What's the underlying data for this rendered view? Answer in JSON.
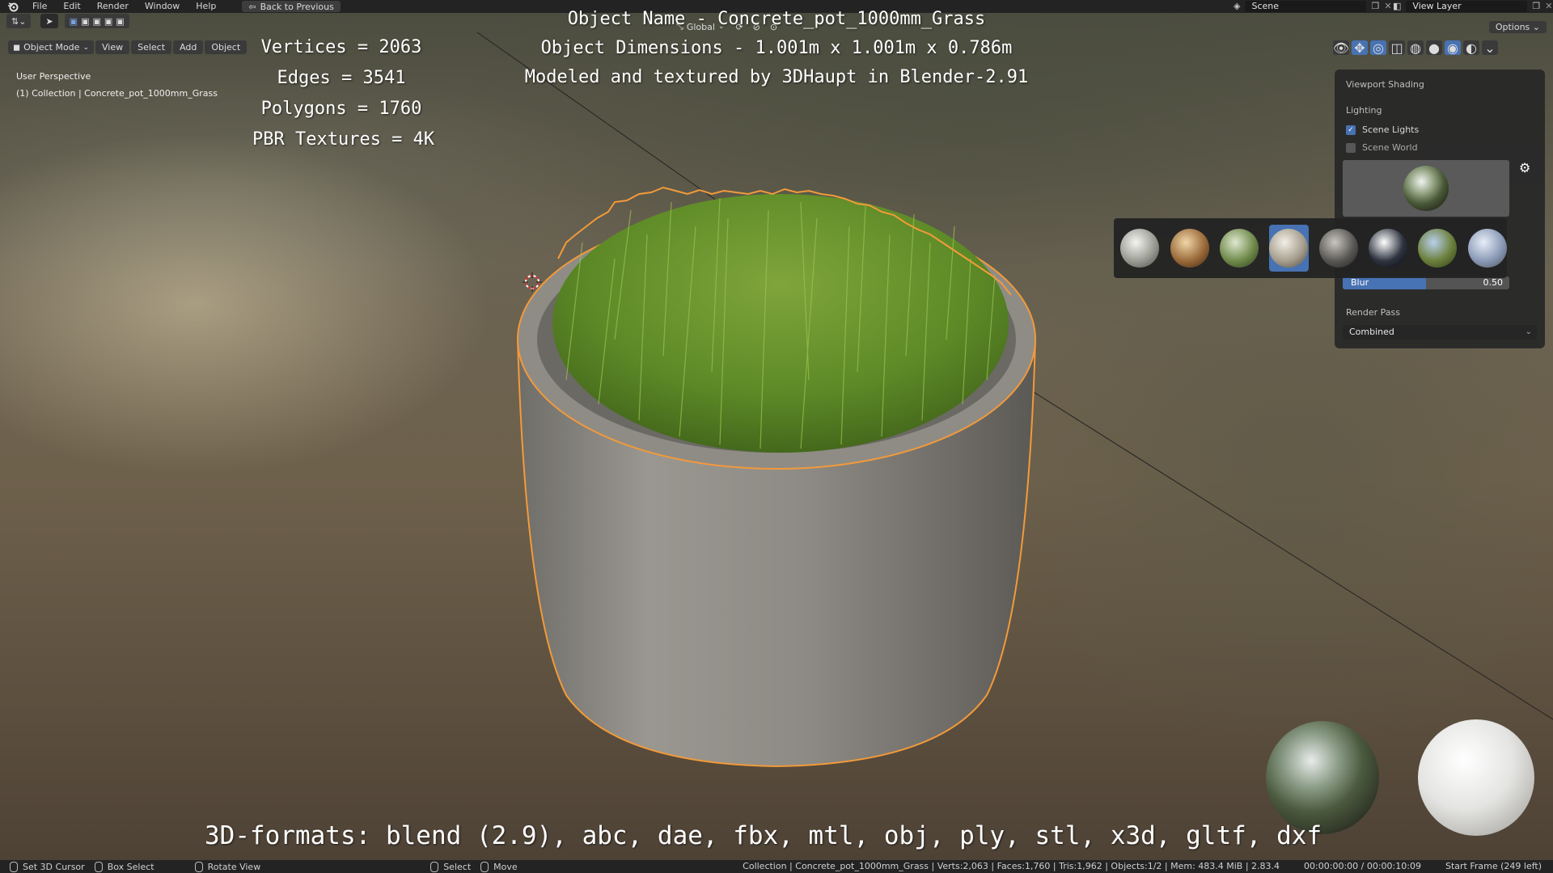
{
  "topbar": {
    "menus": [
      "File",
      "Edit",
      "Render",
      "Window",
      "Help"
    ],
    "back_label": "Back to Previous",
    "scene_label": "Scene",
    "view_layer_label": "View Layer"
  },
  "toolbar": {
    "mode_label": "Object Mode",
    "menus": [
      "View",
      "Select",
      "Add",
      "Object"
    ],
    "transform_orientation": "Global",
    "options_label": "Options"
  },
  "viewport": {
    "perspective_label": "User Perspective",
    "collection_label": "(1) Collection | Concrete_pot_1000mm_Grass"
  },
  "overlay": {
    "stats": [
      "Vertices = 2063",
      "Edges = 3541",
      "Polygons = 1760",
      "PBR Textures = 4K"
    ],
    "title_lines": [
      "Object Name - Concrete_pot_1000mm_Grass",
      "Object Dimensions -  1.001m x 1.001m x 0.786m",
      "Modeled and textured by 3DHaupt in Blender-2.91"
    ],
    "formats": "3D-formats: blend (2.9), abc, dae, fbx, mtl, obj, ply, stl, x3d, gltf, dxf"
  },
  "shading_panel": {
    "title": "Viewport Shading",
    "lighting_label": "Lighting",
    "scene_lights_label": "Scene Lights",
    "scene_lights_checked": true,
    "scene_world_label": "Scene World",
    "scene_world_checked": false,
    "blur_label": "Blur",
    "blur_value": "0.50",
    "blur_fraction": 0.5,
    "render_pass_label": "Render Pass",
    "render_pass_value": "Combined",
    "hdri_count": 8,
    "hdri_selected_index": 3
  },
  "statusbar": {
    "items": [
      "Set 3D Cursor",
      "Box Select",
      "Rotate View",
      "Select",
      "Move"
    ],
    "scene_stats": "Collection | Concrete_pot_1000mm_Grass | Verts:2,063 | Faces:1,760 | Tris:1,962 | Objects:1/2 | Mem: 483.4 MiB | 2.83.4",
    "time": "00:00:00:00 / 00:00:10:09",
    "frame": "Start Frame (249 left)"
  },
  "colors": {
    "accent": "#4772b3",
    "outline": "#f29a3a",
    "grass": "#5c8a2a",
    "concrete": "#8d8a84"
  }
}
